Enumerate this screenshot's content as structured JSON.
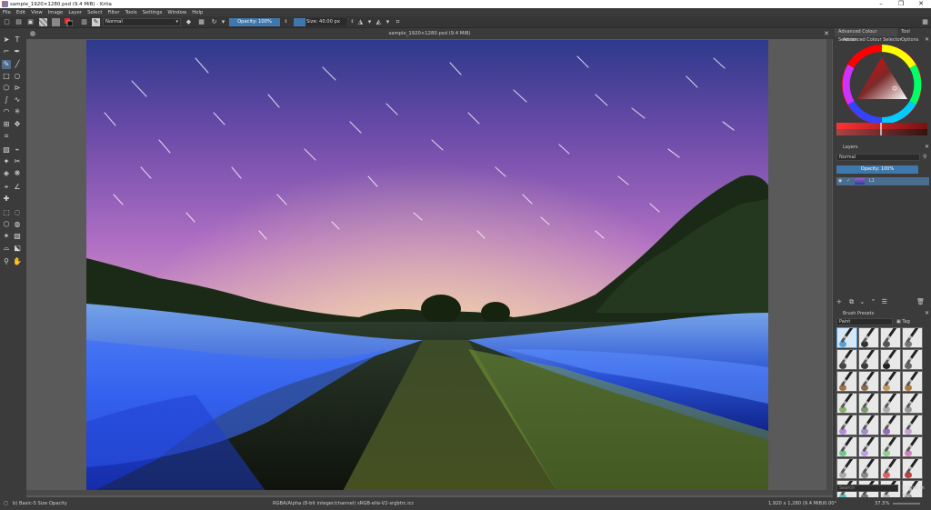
{
  "window": {
    "title": "sample_1920×1280.psd (9.4 MiB) - Krita",
    "controls": [
      "–",
      "❐",
      "✕"
    ]
  },
  "menu": [
    "File",
    "Edit",
    "View",
    "Image",
    "Layer",
    "Select",
    "Filter",
    "Tools",
    "Settings",
    "Window",
    "Help"
  ],
  "toolbar": {
    "blending_mode": "Normal",
    "opacity": "Opacity: 100%",
    "size": "Size: 40.00 px",
    "size_fraction": 0.22
  },
  "document": {
    "tab_title": "sample_1920×1280.psd (9.4 MiB)"
  },
  "dock": {
    "tabs": [
      "Advanced Colour Selector",
      "Tool Options"
    ],
    "color_panel_title": "Advanced Colour Selector",
    "layers_title": "Layers",
    "layers_blending": "Normal",
    "layers_opacity": "Opacity: 100%",
    "layer_name": "L1",
    "brush_presets_title": "Brush Presets",
    "preset_filter": "Paint",
    "tag_label": "Tag",
    "search_placeholder": "Search",
    "filter_in_tag": "Filter in Tag",
    "brushes": [
      {
        "tip": "#5aa0d8"
      },
      {
        "tip": "#333333"
      },
      {
        "tip": "#555555"
      },
      {
        "tip": "#777777"
      },
      {
        "tip": "#444444"
      },
      {
        "tip": "#3a3a3a"
      },
      {
        "tip": "#222222"
      },
      {
        "tip": "#666666"
      },
      {
        "tip": "#a0724a"
      },
      {
        "tip": "#8a6a4a"
      },
      {
        "tip": "#c79a5a"
      },
      {
        "tip": "#b07a40"
      },
      {
        "tip": "#8bb06a"
      },
      {
        "tip": "#7a9a6a"
      },
      {
        "tip": "#aaaaaa"
      },
      {
        "tip": "#999999"
      },
      {
        "tip": "#b38ae0"
      },
      {
        "tip": "#a78ad0"
      },
      {
        "tip": "#9a6ab8"
      },
      {
        "tip": "#c9a0d8"
      },
      {
        "tip": "#70c98a"
      },
      {
        "tip": "#c0a0e0"
      },
      {
        "tip": "#90d090"
      },
      {
        "tip": "#d080c0"
      },
      {
        "tip": "#aaaaaa"
      },
      {
        "tip": "#888888"
      },
      {
        "tip": "#e06060"
      },
      {
        "tip": "#c04040"
      },
      {
        "tip": "#60c0c0"
      },
      {
        "tip": "#777777"
      },
      {
        "tip": "#bbbbbb"
      },
      {
        "tip": "#999999"
      }
    ]
  },
  "status": {
    "brush": "b) Basic-5 Size Opacity",
    "color_info": "RGBA/Alpha (8-bit integer/channel) sRGB-elle-V2-srgbtrc.icc",
    "dimensions": "1,920 x 1,280 (9.4 MiB)",
    "rotation": "0.00°",
    "zoom": "37.5%"
  }
}
